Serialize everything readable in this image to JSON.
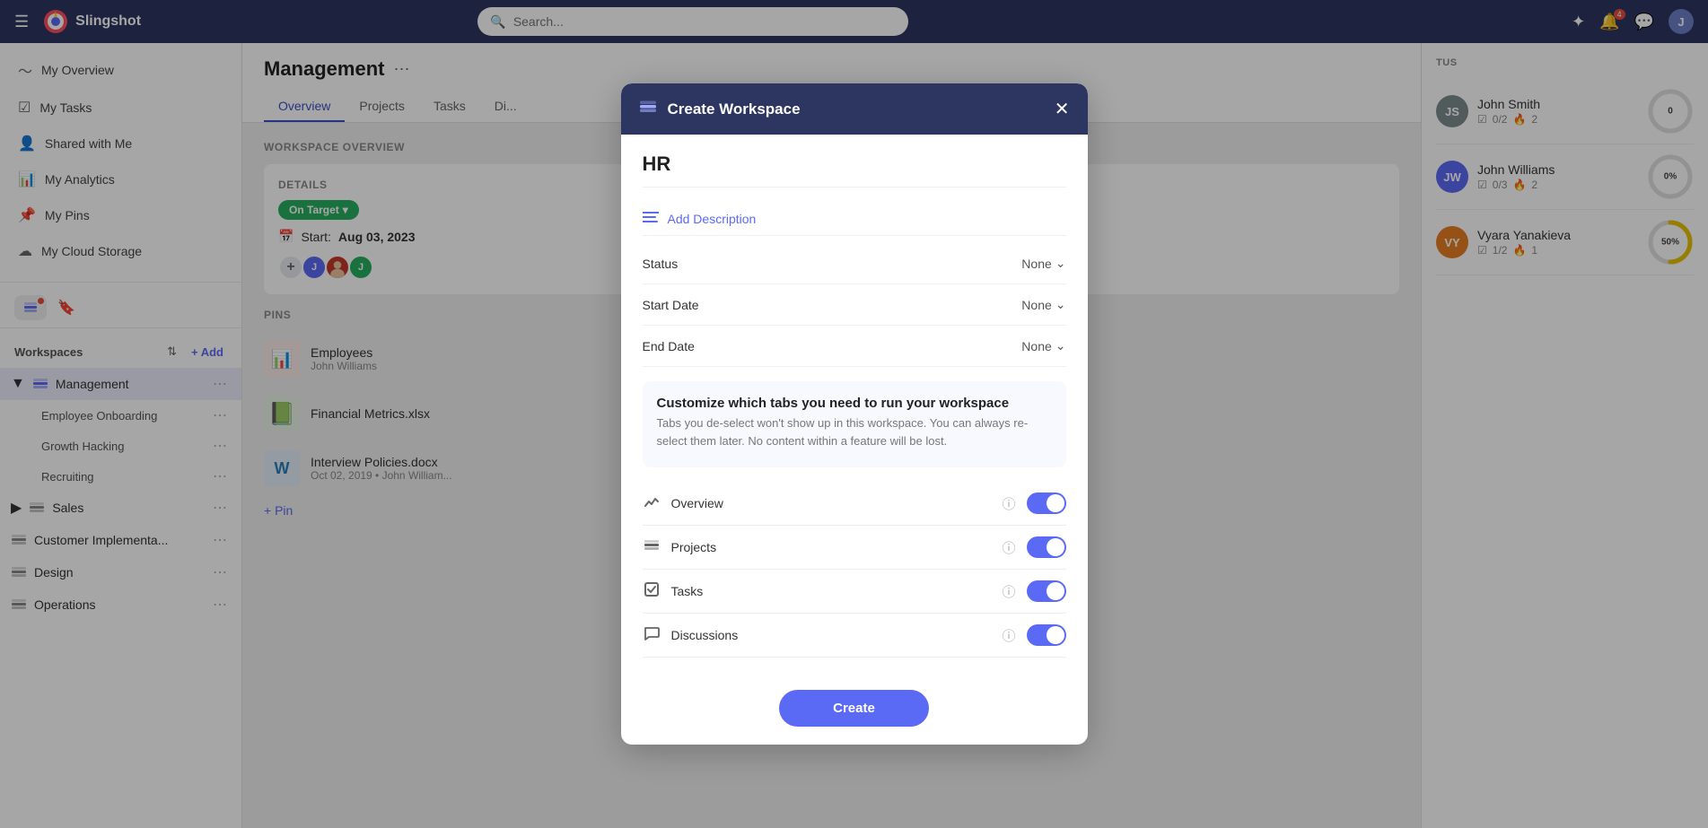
{
  "topbar": {
    "brand": "Slingshot",
    "search_placeholder": "Search...",
    "notif_count": "4",
    "avatar_initial": "J"
  },
  "sidebar": {
    "nav_items": [
      {
        "id": "my-overview",
        "label": "My Overview",
        "icon": "◜"
      },
      {
        "id": "my-tasks",
        "label": "My Tasks",
        "icon": "☑"
      },
      {
        "id": "shared-with-me",
        "label": "Shared with Me",
        "icon": "👤"
      },
      {
        "id": "my-analytics",
        "label": "My Analytics",
        "icon": "📊"
      },
      {
        "id": "my-pins",
        "label": "My Pins",
        "icon": "📌"
      },
      {
        "id": "my-cloud-storage",
        "label": "My Cloud Storage",
        "icon": "☁"
      }
    ],
    "workspaces_label": "Workspaces",
    "add_label": "+ Add",
    "workspace_items": [
      {
        "id": "management",
        "label": "Management",
        "active": true,
        "sub_items": [
          {
            "id": "employee-onboarding",
            "label": "Employee Onboarding"
          },
          {
            "id": "growth-hacking",
            "label": "Growth Hacking"
          },
          {
            "id": "recruiting",
            "label": "Recruiting"
          }
        ]
      },
      {
        "id": "sales",
        "label": "Sales"
      },
      {
        "id": "customer-implementa",
        "label": "Customer Implementa..."
      },
      {
        "id": "design",
        "label": "Design"
      },
      {
        "id": "operations",
        "label": "Operations"
      }
    ]
  },
  "content": {
    "title": "Management",
    "tabs": [
      "Overview",
      "Projects",
      "Tasks",
      "Di..."
    ],
    "active_tab": "Overview",
    "workspace_overview_label": "Workspace Overview",
    "details_label": "DETAILS",
    "on_target": "On Target",
    "start_date_label": "Start:",
    "start_date_value": "Aug 03, 2023",
    "pins_label": "PINS",
    "pins": [
      {
        "id": "employees",
        "name": "Employees",
        "sub": "John Williams",
        "color": "#e74c3c",
        "icon": "📊"
      },
      {
        "id": "financial-metrics",
        "name": "Financial Metrics.xlsx",
        "sub": "",
        "color": "#27ae60",
        "icon": "📗"
      },
      {
        "id": "interview-policies",
        "name": "Interview Policies.docx",
        "sub": "Oct 02, 2019 • John William...",
        "color": "#2980b9",
        "icon": "W"
      }
    ],
    "add_pin_label": "+ Pin"
  },
  "right_panel": {
    "status_label": "TUS",
    "members": [
      {
        "name": "John Smith",
        "tasks": "0/2",
        "fire": "2",
        "progress": 0,
        "color": "#e8c200",
        "bg": "#7f8c8d"
      },
      {
        "name": "John Williams",
        "tasks": "0/3",
        "fire": "2",
        "progress": 0,
        "color": "#9b59b6",
        "bg": "#5b6af5"
      },
      {
        "name": "Vyara Yanakieva",
        "tasks": "1/2",
        "fire": "1",
        "progress": 50,
        "color": "#e8c200",
        "bg": "#e67e22"
      }
    ]
  },
  "modal": {
    "title": "Create Workspace",
    "workspace_name": "HR",
    "add_description_label": "Add Description",
    "status_label": "Status",
    "status_value": "None",
    "start_date_label": "Start Date",
    "start_date_value": "None",
    "end_date_label": "End Date",
    "end_date_value": "None",
    "customize_title": "Customize which tabs you need to run your workspace",
    "customize_desc": "Tabs you de-select won't show up in this workspace. You can always re-select them later. No content within a feature will be lost.",
    "tabs": [
      {
        "id": "overview",
        "label": "Overview",
        "icon": "activity",
        "enabled": true
      },
      {
        "id": "projects",
        "label": "Projects",
        "icon": "layers",
        "enabled": true
      },
      {
        "id": "tasks",
        "label": "Tasks",
        "icon": "checkbox",
        "enabled": true
      },
      {
        "id": "discussions",
        "label": "Discussions",
        "icon": "chat",
        "enabled": true
      }
    ],
    "create_label": "Create"
  }
}
